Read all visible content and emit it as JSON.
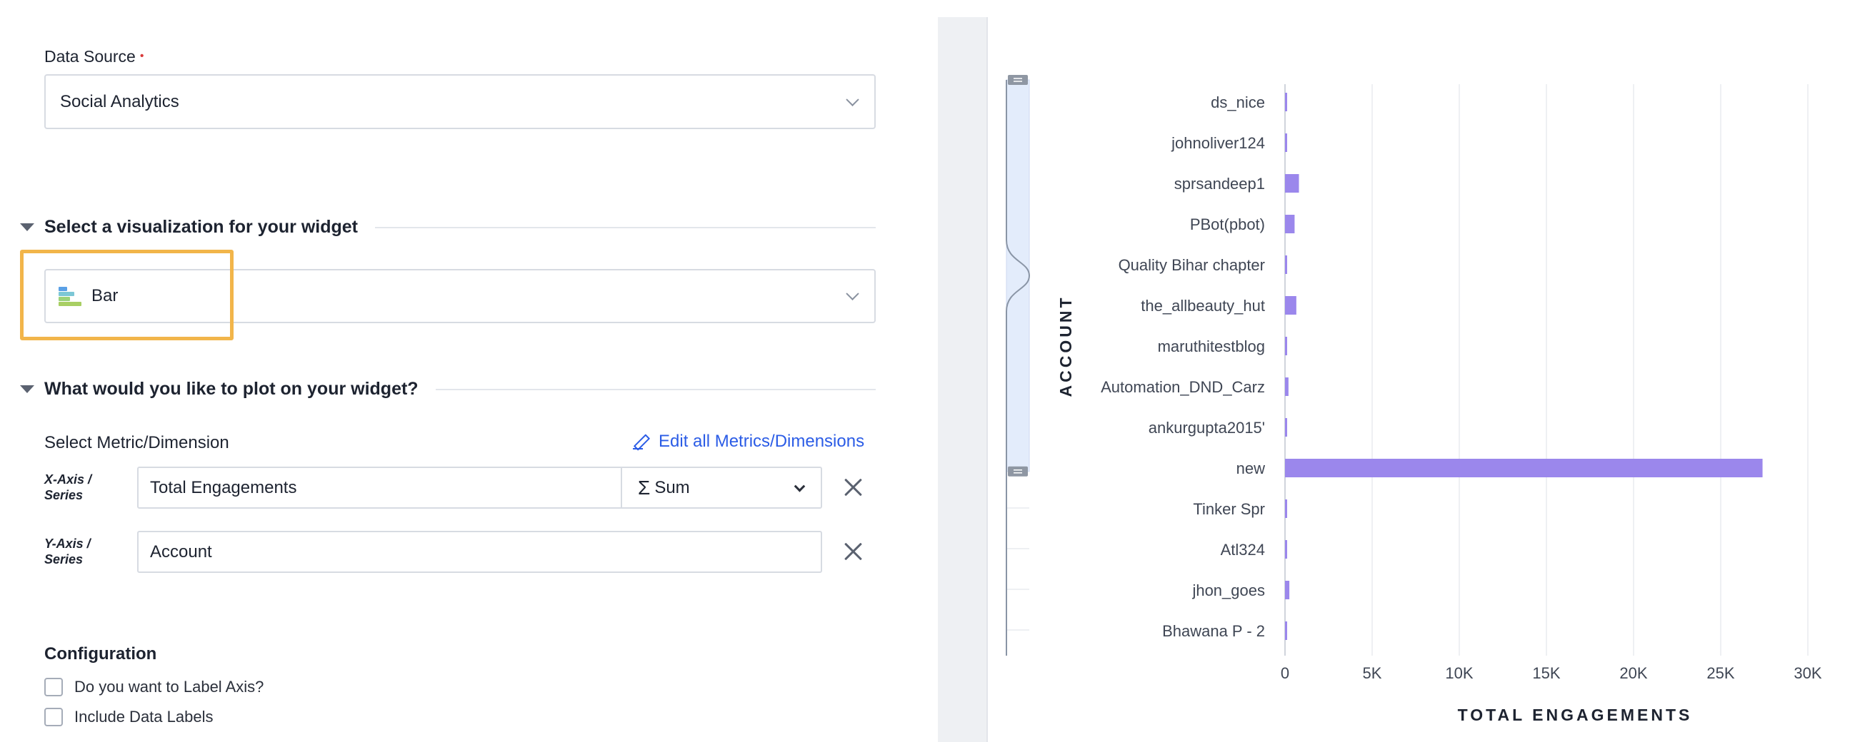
{
  "data_source": {
    "label": "Data Source",
    "required_mark": "•",
    "value": "Social Analytics"
  },
  "visualization_section": {
    "title": "Select a visualization for your widget",
    "selected": "Bar",
    "icon": "bar-chart-icon"
  },
  "plot_section": {
    "title": "What would you like to plot on your widget?",
    "metric_label": "Select Metric/Dimension",
    "edit_link": "Edit all Metrics/Dimensions",
    "x_axis": {
      "label_line1": "X-Axis /",
      "label_line2": "Series",
      "value": "Total Engagements",
      "aggregation": "Sum",
      "aggregation_symbol": "Σ"
    },
    "y_axis": {
      "label_line1": "Y-Axis /",
      "label_line2": "Series",
      "value": "Account"
    }
  },
  "configuration": {
    "title": "Configuration",
    "options": [
      {
        "label": "Do you want to Label Axis?",
        "checked": false
      },
      {
        "label": "Include Data Labels",
        "checked": false
      }
    ]
  },
  "colors": {
    "bar": "#9b87ec",
    "highlight": "#f2b54a",
    "link": "#2b5ce6"
  },
  "chart_data": {
    "type": "bar",
    "orientation": "horizontal",
    "categories": [
      "ds_nice",
      "johnoliver124",
      "sprsandeep1",
      "PBot(pbot)",
      "Quality Bihar chapter",
      "the_allbeauty_hut",
      "maruthitestblog",
      "Automation_DND_Carz",
      "ankurgupta2015'",
      "new",
      "Tinker Spr",
      "Atl324",
      "jhon_goes",
      "Bhawana P - 2"
    ],
    "values": [
      100,
      100,
      800,
      550,
      100,
      650,
      100,
      200,
      100,
      27400,
      100,
      100,
      250,
      100
    ],
    "xlabel": "TOTAL ENGAGEMENTS",
    "ylabel": "ACCOUNT",
    "xlim": [
      0,
      30000
    ],
    "xticks": [
      "0",
      "5K",
      "10K",
      "15K",
      "20K",
      "25K",
      "30K"
    ],
    "xtick_values": [
      0,
      5000,
      10000,
      15000,
      20000,
      25000,
      30000
    ],
    "grid": true,
    "scroll_window": [
      0,
      0.68
    ]
  }
}
